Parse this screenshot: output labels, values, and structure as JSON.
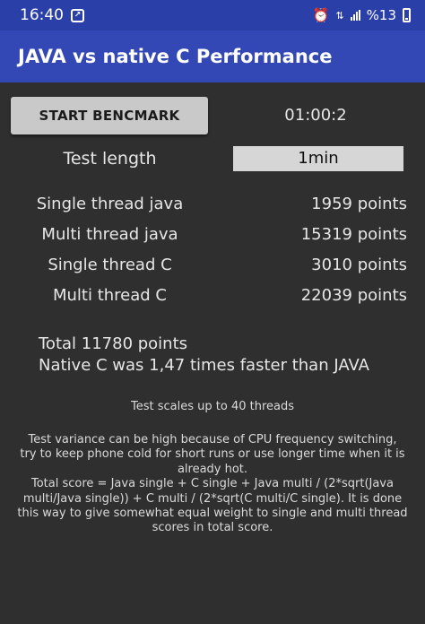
{
  "status_bar": {
    "time": "16:40",
    "battery": "%13"
  },
  "app_bar": {
    "title": "JAVA vs native C Performance"
  },
  "controls": {
    "start_button": "START BENCMARK",
    "timer": "01:00:2",
    "test_length_label": "Test length",
    "test_length_value": "1min"
  },
  "results": [
    {
      "label": "Single thread java",
      "value": "1959 points"
    },
    {
      "label": "Multi thread java",
      "value": "15319 points"
    },
    {
      "label": "Single thread C",
      "value": "3010 points"
    },
    {
      "label": "Multi thread C",
      "value": "22039 points"
    }
  ],
  "summary": {
    "total": "Total 11780 points",
    "comparison": "Native C was 1,47 times faster than JAVA"
  },
  "notes": {
    "scale": "Test scales up to 40 threads",
    "variance_line1": "Test variance can be high because of CPU frequency switching,",
    "variance_line2": "try to keep phone cold for short runs or use longer time when it is",
    "variance_line3": "already hot.",
    "formula_line1": "Total score = Java single + C single + Java multi / (2*sqrt(Java",
    "formula_line2": "multi/Java single)) + C multi / (2*sqrt(C multi/C single). It is done",
    "formula_line3": "this way to give somewhat equal weight to single and multi thread",
    "formula_line4": "scores in total score."
  },
  "colors": {
    "status_bar": "#2b3fa8",
    "app_bar": "#3347b5",
    "background": "#2f2f2f"
  },
  "icons": [
    "alarm-icon",
    "signal-icon",
    "battery-icon",
    "screenshot-icon"
  ]
}
